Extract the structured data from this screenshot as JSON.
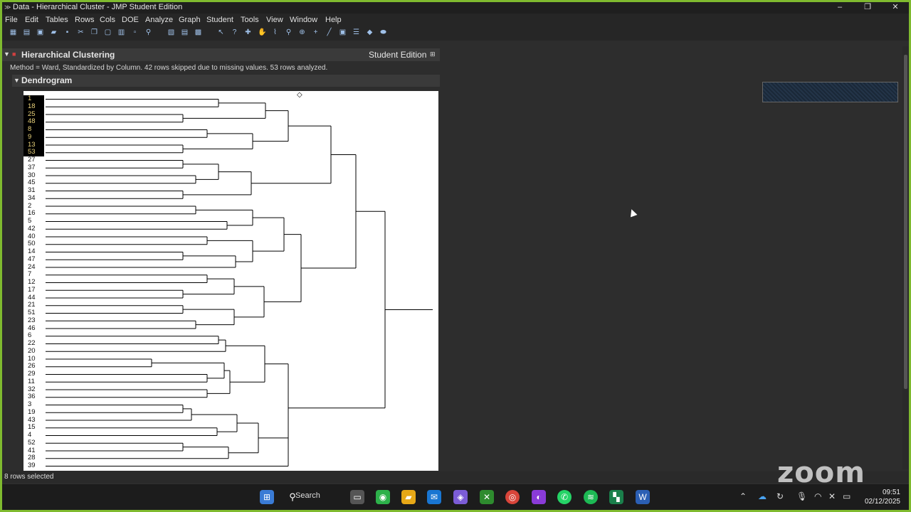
{
  "window": {
    "title": "Data - Hierarchical Cluster - JMP Student Edition",
    "controls": [
      "–",
      "❐",
      "✕"
    ]
  },
  "menu": [
    "File",
    "Edit",
    "Tables",
    "Rows",
    "Cols",
    "DOE",
    "Analyze",
    "Graph",
    "Student",
    "Tools",
    "View",
    "Window",
    "Help"
  ],
  "report": {
    "title": "Hierarchical Clustering",
    "edition": "Student Edition",
    "method": "Method = Ward, Standardized by Column.  42 rows skipped due to missing values.  53 rows analyzed.",
    "dendrogram_title": "Dendrogram"
  },
  "dendrogram": {
    "leaves": [
      "1",
      "18",
      "25",
      "48",
      "8",
      "9",
      "13",
      "53",
      "27",
      "37",
      "30",
      "45",
      "31",
      "34",
      "2",
      "16",
      "5",
      "42",
      "40",
      "50",
      "14",
      "47",
      "24",
      "7",
      "12",
      "17",
      "44",
      "21",
      "51",
      "23",
      "46",
      "6",
      "22",
      "20",
      "10",
      "26",
      "29",
      "11",
      "32",
      "36",
      "3",
      "19",
      "43",
      "15",
      "4",
      "52",
      "41",
      "28",
      "39"
    ],
    "selected_count": 8
  },
  "status": {
    "text": "8 rows selected"
  },
  "overlay": {
    "brand": "zoom"
  },
  "taskbar": {
    "search_label": "Search",
    "time": "09:51",
    "date": "02/12/2025"
  }
}
